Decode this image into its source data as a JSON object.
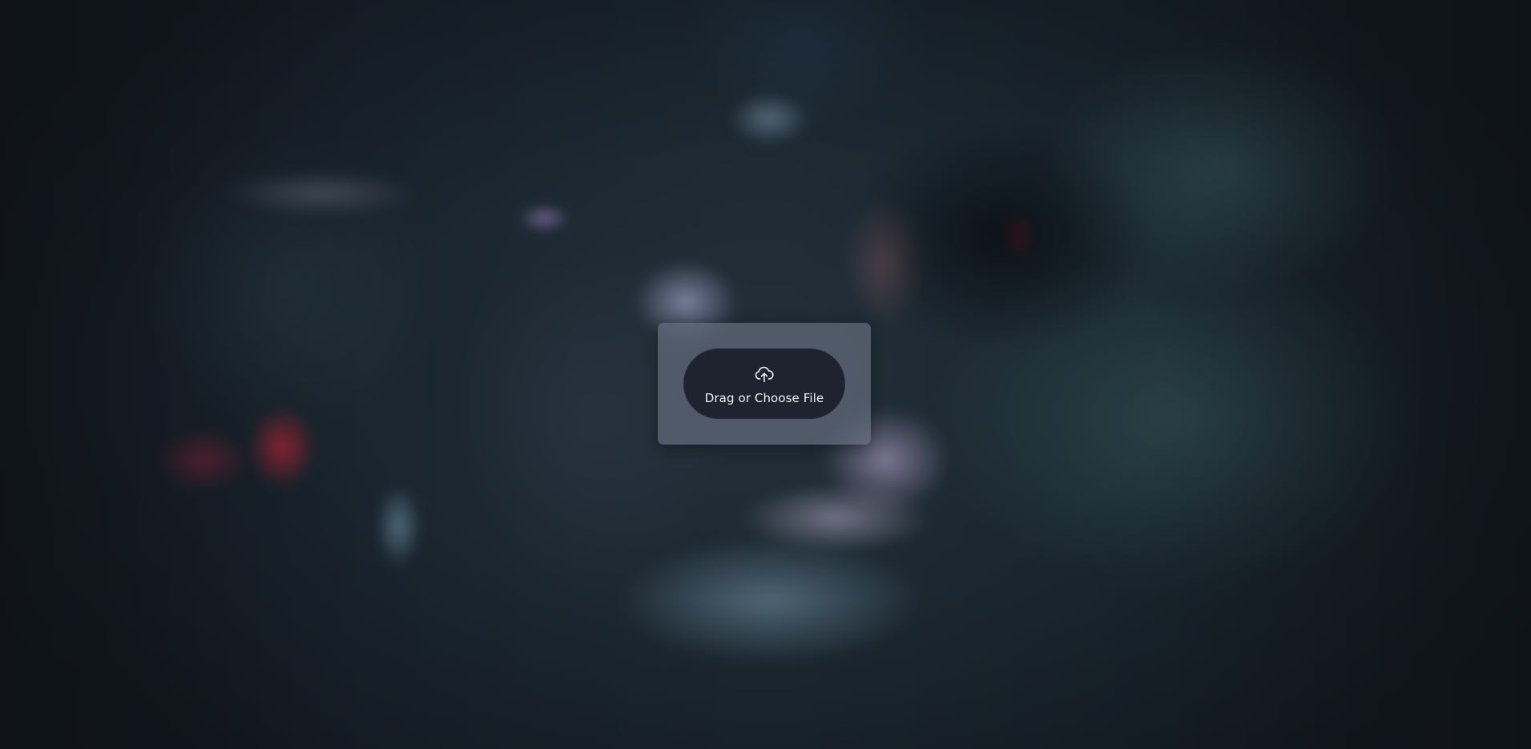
{
  "upload": {
    "label": "Drag or Choose File",
    "icon": "cloud-upload-icon"
  },
  "colors": {
    "card_background": "#6e7686",
    "button_background": "#1f2330",
    "label_color": "#eef1f6"
  }
}
